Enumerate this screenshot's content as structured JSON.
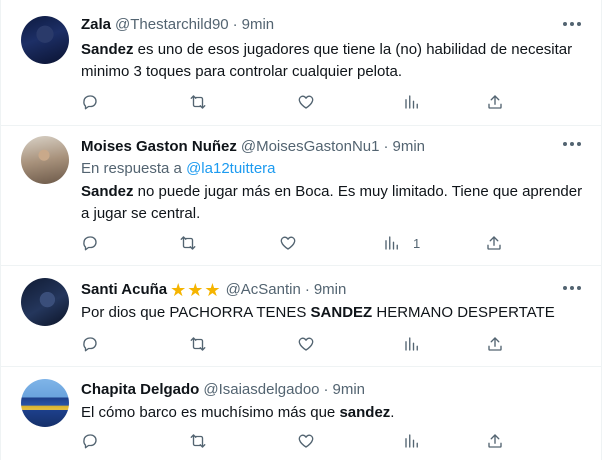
{
  "tweets": [
    {
      "name": "Zala",
      "handle": "@Thestarchild90",
      "dot": "·",
      "time": "9min",
      "text": [
        {
          "t": "Sandez",
          "b": true
        },
        {
          "t": " es uno de esos jugadores que tiene la (no) habilidad de necesitar minimo 3 toques para controlar cualquier pelota.",
          "b": false
        }
      ],
      "stats": {
        "views": ""
      }
    },
    {
      "name": "Moises Gaston Nuñez",
      "handle": "@MoisesGastonNu1",
      "dot": "·",
      "time": "9min",
      "reply_prefix": "En respuesta a",
      "reply_handle": "@la12tuittera",
      "text": [
        {
          "t": "Sandez",
          "b": true
        },
        {
          "t": " no puede jugar más en Boca. Es muy limitado. Tiene que aprender a jugar se central.",
          "b": false
        }
      ],
      "stats": {
        "views": "1"
      }
    },
    {
      "name": "Santi Acuña",
      "stars": "★★★",
      "handle": "@AcSantin",
      "dot": "·",
      "time": "9min",
      "text": [
        {
          "t": "Por dios que PACHORRA TENES ",
          "b": false
        },
        {
          "t": "SANDEZ",
          "b": true
        },
        {
          "t": " HERMANO DESPERTATE",
          "b": false
        }
      ],
      "stats": {
        "views": ""
      }
    },
    {
      "name": "Chapita Delgado",
      "handle": "@Isaiasdelgadoo",
      "dot": "·",
      "time": "9min",
      "text": [
        {
          "t": "El cómo barco es muchísimo más que ",
          "b": false
        },
        {
          "t": "sandez",
          "b": true
        },
        {
          "t": ".",
          "b": false
        }
      ],
      "stats": {
        "views": ""
      }
    }
  ],
  "icons": {
    "more": "more-horizontal-icon",
    "reply": "reply-icon",
    "retweet": "retweet-icon",
    "like": "heart-icon",
    "views": "views-bar-chart-icon",
    "share": "share-icon"
  },
  "colors": {
    "text": "#0f1419",
    "secondary": "#536471",
    "link": "#1d9bf0",
    "divider": "#eff3f4",
    "star": "#f5b400"
  }
}
